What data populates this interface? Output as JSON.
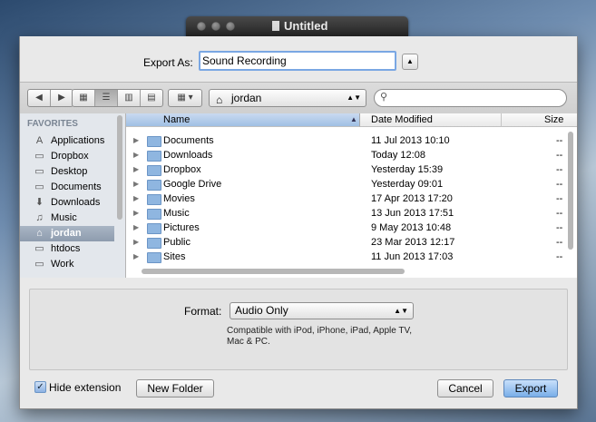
{
  "window": {
    "title": "Untitled"
  },
  "export": {
    "label": "Export As:",
    "value": "Sound Recording"
  },
  "toolbar": {
    "location": "jordan",
    "search_placeholder": ""
  },
  "sidebar": {
    "heading": "FAVORITES",
    "items": [
      {
        "label": "Applications",
        "icon": "applications-icon"
      },
      {
        "label": "Dropbox",
        "icon": "folder-icon"
      },
      {
        "label": "Desktop",
        "icon": "folder-icon"
      },
      {
        "label": "Documents",
        "icon": "folder-icon"
      },
      {
        "label": "Downloads",
        "icon": "downloads-icon"
      },
      {
        "label": "Music",
        "icon": "music-icon"
      },
      {
        "label": "jordan",
        "icon": "home-icon",
        "selected": true
      },
      {
        "label": "htdocs",
        "icon": "folder-icon"
      },
      {
        "label": "Work",
        "icon": "folder-icon"
      }
    ]
  },
  "files": {
    "columns": {
      "name": "Name",
      "date": "Date Modified",
      "size": "Size"
    },
    "rows": [
      {
        "name": "Documents",
        "date": "11 Jul 2013 10:10",
        "size": "--"
      },
      {
        "name": "Downloads",
        "date": "Today 12:08",
        "size": "--"
      },
      {
        "name": "Dropbox",
        "date": "Yesterday 15:39",
        "size": "--"
      },
      {
        "name": "Google Drive",
        "date": "Yesterday 09:01",
        "size": "--"
      },
      {
        "name": "Movies",
        "date": "17 Apr 2013 17:20",
        "size": "--"
      },
      {
        "name": "Music",
        "date": "13 Jun 2013 17:51",
        "size": "--"
      },
      {
        "name": "Pictures",
        "date": "9 May 2013 10:48",
        "size": "--"
      },
      {
        "name": "Public",
        "date": "23 Mar 2013 12:17",
        "size": "--"
      },
      {
        "name": "Sites",
        "date": "11 Jun 2013 17:03",
        "size": "--"
      }
    ]
  },
  "format": {
    "label": "Format:",
    "value": "Audio Only",
    "description": "Compatible with iPod, iPhone, iPad, Apple TV, Mac & PC."
  },
  "footer": {
    "hide_extension": "Hide extension",
    "hide_extension_checked": true,
    "new_folder": "New Folder",
    "cancel": "Cancel",
    "export": "Export"
  },
  "colors": {
    "accent": "#7aa7e3",
    "selection": "#8e9cae"
  }
}
